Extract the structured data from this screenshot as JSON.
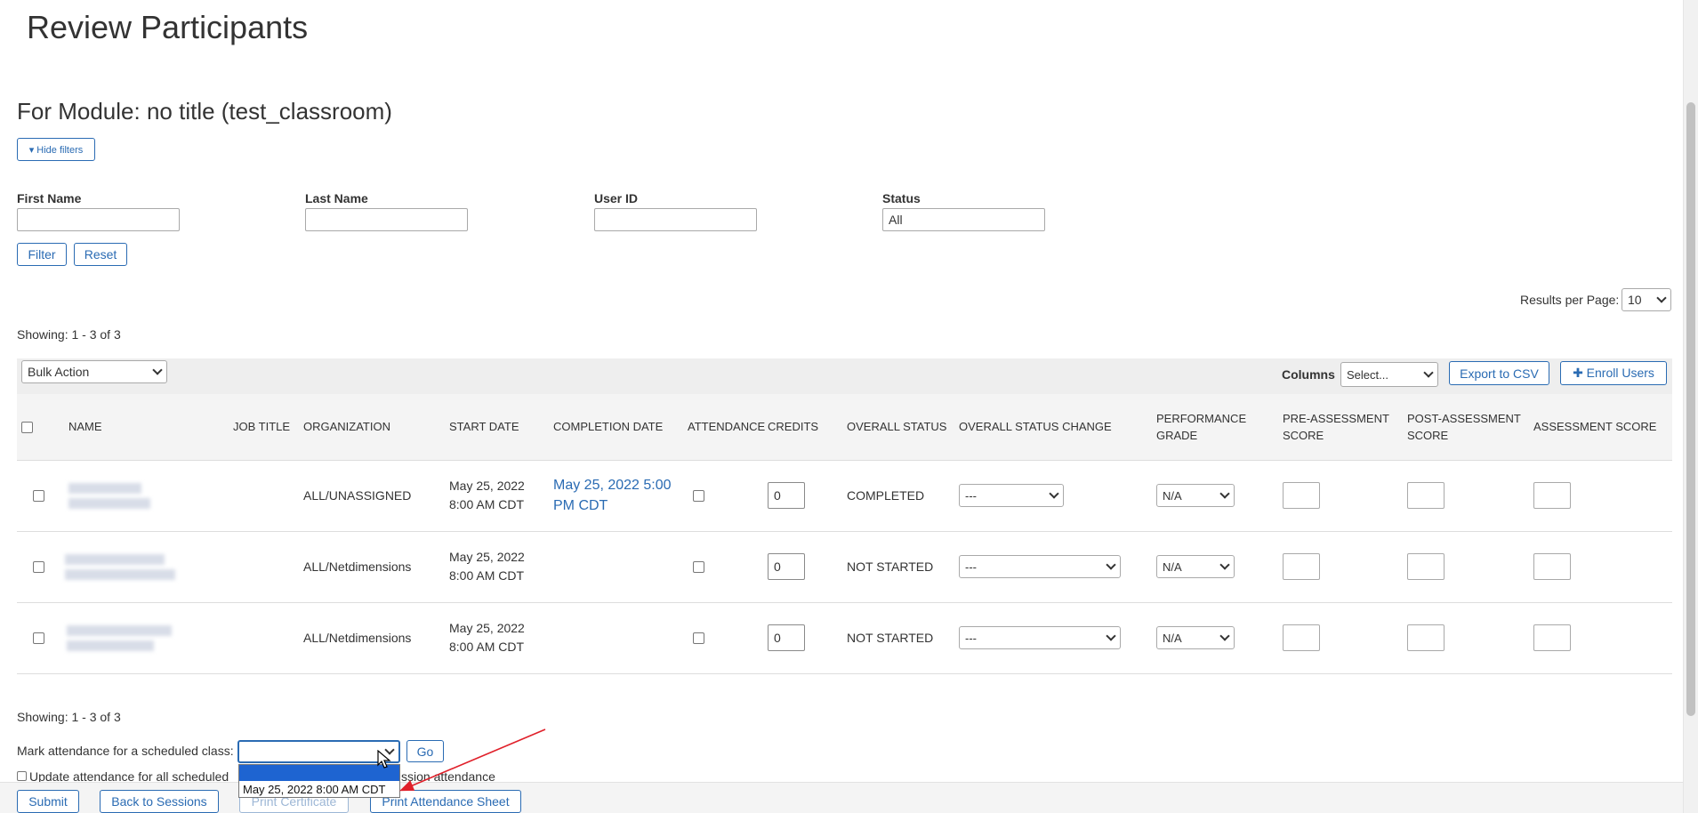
{
  "page": {
    "title": "Review Participants",
    "module_title": "For Module: no title (test_classroom)",
    "hide_filters_label": "▾ Hide filters"
  },
  "filters": {
    "first_name_label": "First Name",
    "first_name_value": "",
    "last_name_label": "Last Name",
    "last_name_value": "",
    "user_id_label": "User ID",
    "user_id_value": "",
    "status_label": "Status",
    "status_value": "All",
    "filter_button": "Filter",
    "reset_button": "Reset"
  },
  "results": {
    "per_page_label": "Results per Page:",
    "per_page_value": "10",
    "showing_top": "Showing: 1 - 3 of 3",
    "showing_bottom": "Showing: 1 - 3 of 3"
  },
  "toolbar": {
    "bulk_action": "Bulk Action",
    "columns_label": "Columns",
    "columns_value": "Select...",
    "export_csv": "Export to CSV",
    "enroll_users": "✚ Enroll Users"
  },
  "table": {
    "headers": {
      "name": "NAME",
      "job_title": "JOB TITLE",
      "organization": "ORGANIZATION",
      "start_date": "START DATE",
      "completion_date": "COMPLETION DATE",
      "attendance": "ATTENDANCE",
      "credits": "CREDITS",
      "overall_status": "OVERALL STATUS",
      "overall_status_change": "OVERALL STATUS CHANGE",
      "performance_grade": "PERFORMANCE GRADE",
      "pre_assessment": "PRE-ASSESSMENT SCORE",
      "post_assessment": "POST-ASSESSMENT SCORE",
      "assessment": "ASSESSMENT SCORE"
    },
    "rows": [
      {
        "organization": "ALL/UNASSIGNED",
        "start_date": "May 25, 2022 8:00 AM CDT",
        "completion_date": "May 25, 2022 5:00 PM CDT",
        "credits": "0",
        "overall_status": "COMPLETED",
        "status_change": "---",
        "grade": "N/A"
      },
      {
        "organization": "ALL/Netdimensions",
        "start_date": "May 25, 2022 8:00 AM CDT",
        "completion_date": "",
        "credits": "0",
        "overall_status": "NOT STARTED",
        "status_change": "---",
        "grade": "N/A"
      },
      {
        "organization": "ALL/Netdimensions",
        "start_date": "May 25, 2022 8:00 AM CDT",
        "completion_date": "",
        "credits": "0",
        "overall_status": "NOT STARTED",
        "status_change": "---",
        "grade": "N/A"
      }
    ]
  },
  "attendance": {
    "mark_label": "Mark attendance for a scheduled class:",
    "go_button": "Go",
    "update_label_left": "Update attendance for all scheduled",
    "update_label_right": "ssion attendance",
    "dropdown_option": "May 25, 2022 8:00 AM CDT"
  },
  "footer": {
    "submit": "Submit",
    "back_to_sessions": "Back to Sessions",
    "print_certificate": "Print Certificate",
    "print_attendance_sheet": "Print Attendance Sheet"
  },
  "colors": {
    "link_blue": "#2a6bb3",
    "annotation_red": "#e0202a",
    "selection_blue": "#1e64d1"
  }
}
